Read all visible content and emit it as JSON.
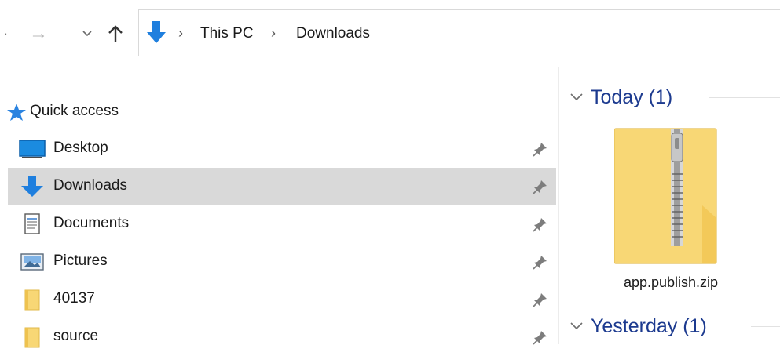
{
  "breadcrumbs": [
    "This PC",
    "Downloads"
  ],
  "separator": "›",
  "nav": {
    "back_glyph": "·",
    "forward_glyph": "→",
    "recent_glyph": "⌄",
    "up_glyph": "↑"
  },
  "sidebar": {
    "quick_access": "Quick access",
    "items": [
      {
        "label": "Desktop",
        "icon": "desktop-icon",
        "pinned": true
      },
      {
        "label": "Downloads",
        "icon": "downloads-icon",
        "pinned": true,
        "selected": true
      },
      {
        "label": "Documents",
        "icon": "documents-icon",
        "pinned": true
      },
      {
        "label": "Pictures",
        "icon": "pictures-icon",
        "pinned": true
      },
      {
        "label": "40137",
        "icon": "folder-icon",
        "pinned": true
      },
      {
        "label": "source",
        "icon": "folder-icon",
        "pinned": true
      }
    ]
  },
  "content": {
    "groups": [
      {
        "label": "Today (1)",
        "files": [
          {
            "name": "app.publish.zip",
            "icon": "zip-folder-icon"
          }
        ]
      },
      {
        "label": "Yesterday (1)"
      }
    ]
  },
  "colors": {
    "selection": "#d9d9d9",
    "group_header": "#1c3a8f",
    "accent_blue": "#1f7fde",
    "folder_yellow": "#f8d775"
  }
}
